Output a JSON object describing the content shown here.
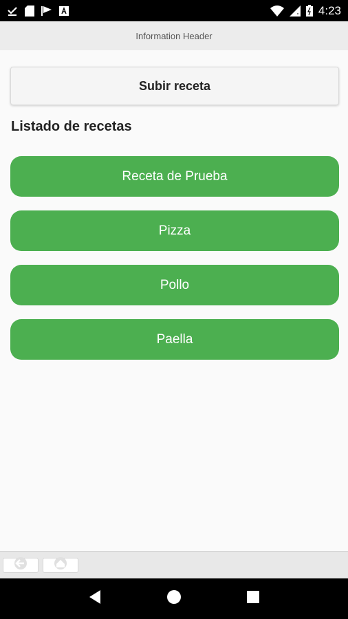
{
  "status_bar": {
    "time": "4:23",
    "left_icons": [
      "download-done-icon",
      "sd-card-icon",
      "flag-icon",
      "app-notification-icon"
    ],
    "right_icons": [
      "wifi-icon",
      "signal-icon",
      "battery-icon"
    ]
  },
  "header": {
    "title": "Information Header"
  },
  "main": {
    "upload_label": "Subir receta",
    "list_title": "Listado de recetas",
    "recipes": [
      {
        "label": "Receta de Prueba"
      },
      {
        "label": "Pizza"
      },
      {
        "label": "Pollo"
      },
      {
        "label": "Paella"
      }
    ]
  },
  "toolbar": {
    "icons": [
      "back-arrow-icon",
      "home-icon"
    ]
  },
  "nav": {
    "icons": [
      "back-icon",
      "home-circle-icon",
      "recents-icon"
    ]
  },
  "colors": {
    "accent": "#4caf50",
    "header_bg": "#ececec",
    "page_bg": "#fafafa"
  }
}
